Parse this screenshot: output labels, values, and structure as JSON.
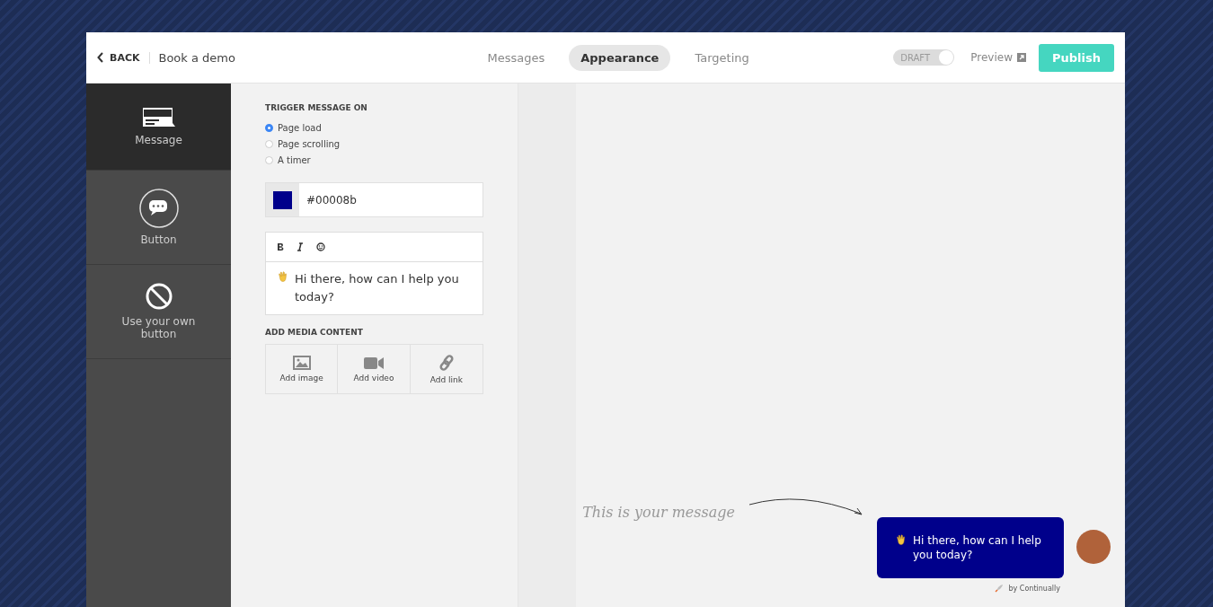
{
  "header": {
    "back": "BACK",
    "title": "Book a demo",
    "tabs": [
      {
        "label": "Messages",
        "selected": false
      },
      {
        "label": "Appearance",
        "selected": true
      },
      {
        "label": "Targeting",
        "selected": false
      }
    ],
    "draft_toggle": {
      "label": "DRAFT",
      "on": false
    },
    "preview": "Preview",
    "publish": "Publish"
  },
  "sidebar": {
    "items": [
      {
        "kind": "message",
        "label": "Message",
        "selected": true
      },
      {
        "kind": "button",
        "label": "Button",
        "selected": false
      },
      {
        "kind": "own",
        "label": "Use your own button",
        "selected": false
      }
    ]
  },
  "settings": {
    "trigger_title": "TRIGGER MESSAGE ON",
    "triggers": [
      {
        "label": "Page load",
        "selected": true
      },
      {
        "label": "Page scrolling",
        "selected": false
      },
      {
        "label": "A timer",
        "selected": false
      }
    ],
    "color_value": "#00008b",
    "editor": {
      "text": "Hi there, how can I help you today?"
    },
    "media_title": "ADD MEDIA CONTENT",
    "media": [
      {
        "kind": "image",
        "label": "Add image"
      },
      {
        "kind": "video",
        "label": "Add video"
      },
      {
        "kind": "link",
        "label": "Add link"
      }
    ]
  },
  "preview": {
    "caption": "This is your message",
    "bubble_text": "Hi there, how can I help you today?",
    "credit": "by Continually"
  }
}
